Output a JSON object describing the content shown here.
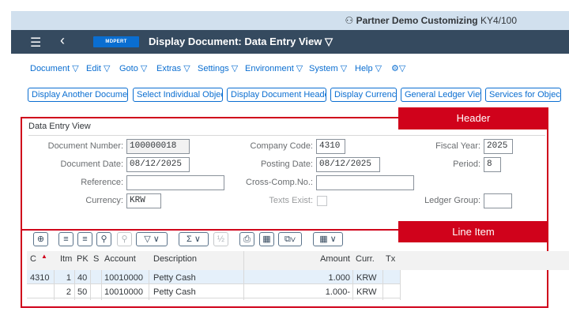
{
  "system": {
    "partner_icon": "user-group-icon",
    "system_name": "Partner Demo Customizing",
    "client": "KY4/100"
  },
  "shell": {
    "title": "Display Document: Data Entry View ▽",
    "logo_text": "MDPERT"
  },
  "menu": {
    "items": [
      "Document ▽",
      "Edit ▽",
      "Goto ▽",
      "Extras ▽",
      "Settings ▽",
      "Environment ▽",
      "System ▽",
      "Help ▽",
      "⚙▽"
    ]
  },
  "toolbar": {
    "buttons": [
      "Display Another Document",
      "Select Individual Object",
      "Display Document Header",
      "Display Currency",
      "General Ledger View",
      "Services for Object ▾"
    ]
  },
  "header_section": {
    "annotation": "Header",
    "panel_title": "Data Entry View",
    "document_number_label": "Document Number:",
    "document_number": "100000018",
    "company_code_label": "Company Code:",
    "company_code": "4310",
    "fiscal_year_label": "Fiscal Year:",
    "fiscal_year": "2025",
    "document_date_label": "Document Date:",
    "document_date": "08/12/2025",
    "posting_date_label": "Posting Date:",
    "posting_date": "08/12/2025",
    "period_label": "Period:",
    "period": "8",
    "reference_label": "Reference:",
    "reference": "",
    "cross_comp_label": "Cross-Comp.No.:",
    "cross_comp": "",
    "currency_label": "Currency:",
    "currency": "KRW",
    "texts_exist_label": "Texts Exist:",
    "ledger_group_label": "Ledger Group:",
    "ledger_group": ""
  },
  "line_item_section": {
    "annotation": "Line Item",
    "columns": [
      "C",
      "Itm",
      "PK",
      "S",
      "Account",
      "Description",
      "Amount",
      "Curr.",
      "Tx"
    ],
    "rows": [
      {
        "c": "4310",
        "itm": "1",
        "pk": "40",
        "s": "",
        "account": "10010000",
        "description": "Petty Cash",
        "amount": "1.000",
        "curr": "KRW",
        "tx": ""
      },
      {
        "c": "",
        "itm": "2",
        "pk": "50",
        "s": "",
        "account": "10010000",
        "description": "Petty Cash",
        "amount": "1.000-",
        "curr": "KRW",
        "tx": ""
      }
    ]
  },
  "colors": {
    "shell": "#354a5f",
    "accent": "#0a6ed1",
    "annotation_red": "#d0021b"
  }
}
